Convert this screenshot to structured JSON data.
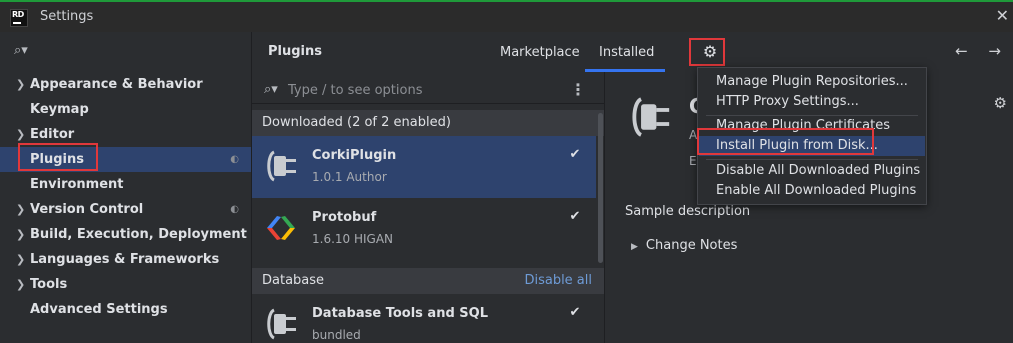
{
  "window": {
    "title": "Settings"
  },
  "sidebar": {
    "search_placeholder": "",
    "items": [
      {
        "label": "Appearance & Behavior",
        "expandable": true
      },
      {
        "label": "Keymap",
        "expandable": false
      },
      {
        "label": "Editor",
        "expandable": true
      },
      {
        "label": "Plugins",
        "expandable": false,
        "selected": true
      },
      {
        "label": "Environment",
        "expandable": false
      },
      {
        "label": "Version Control",
        "expandable": true
      },
      {
        "label": "Build, Execution, Deployment",
        "expandable": true
      },
      {
        "label": "Languages & Frameworks",
        "expandable": true
      },
      {
        "label": "Tools",
        "expandable": true
      },
      {
        "label": "Advanced Settings",
        "expandable": false
      }
    ]
  },
  "header": {
    "title": "Plugins",
    "tabs": [
      {
        "label": "Marketplace"
      },
      {
        "label": "Installed",
        "active": true
      }
    ]
  },
  "plugin_list": {
    "search_placeholder": "Type / to see options",
    "groups": [
      {
        "title": "Downloaded (2 of 2 enabled)",
        "plugins": [
          {
            "name": "CorkiPlugin",
            "meta": "1.0.1  Author",
            "enabled": true,
            "icon": "plug-icon",
            "selected": true
          },
          {
            "name": "Protobuf",
            "meta": "1.6.10  HIGAN",
            "enabled": true,
            "icon": "protobuf-logo-icon"
          }
        ]
      },
      {
        "title": "Database",
        "action": "Disable all",
        "plugins": [
          {
            "name": "Database Tools and SQL",
            "meta": "bundled",
            "enabled": true,
            "icon": "plug-icon"
          }
        ]
      }
    ]
  },
  "detail": {
    "name": "C",
    "info1": "A",
    "info2": "E",
    "description": "Sample description",
    "change_notes": "Change Notes"
  },
  "gear_menu": {
    "items": [
      {
        "label": "Manage Plugin Repositories..."
      },
      {
        "label": "HTTP Proxy Settings..."
      },
      {
        "label": "Manage Plugin Certificates"
      },
      {
        "label": "Install Plugin from Disk...",
        "active": true
      },
      {
        "label": "Disable All Downloaded Plugins"
      },
      {
        "label": "Enable All Downloaded Plugins"
      }
    ]
  },
  "colors": {
    "accent": "#3574f0",
    "selection": "#2e436e",
    "highlight_box": "#e0383b",
    "background": "#2b2d30"
  }
}
